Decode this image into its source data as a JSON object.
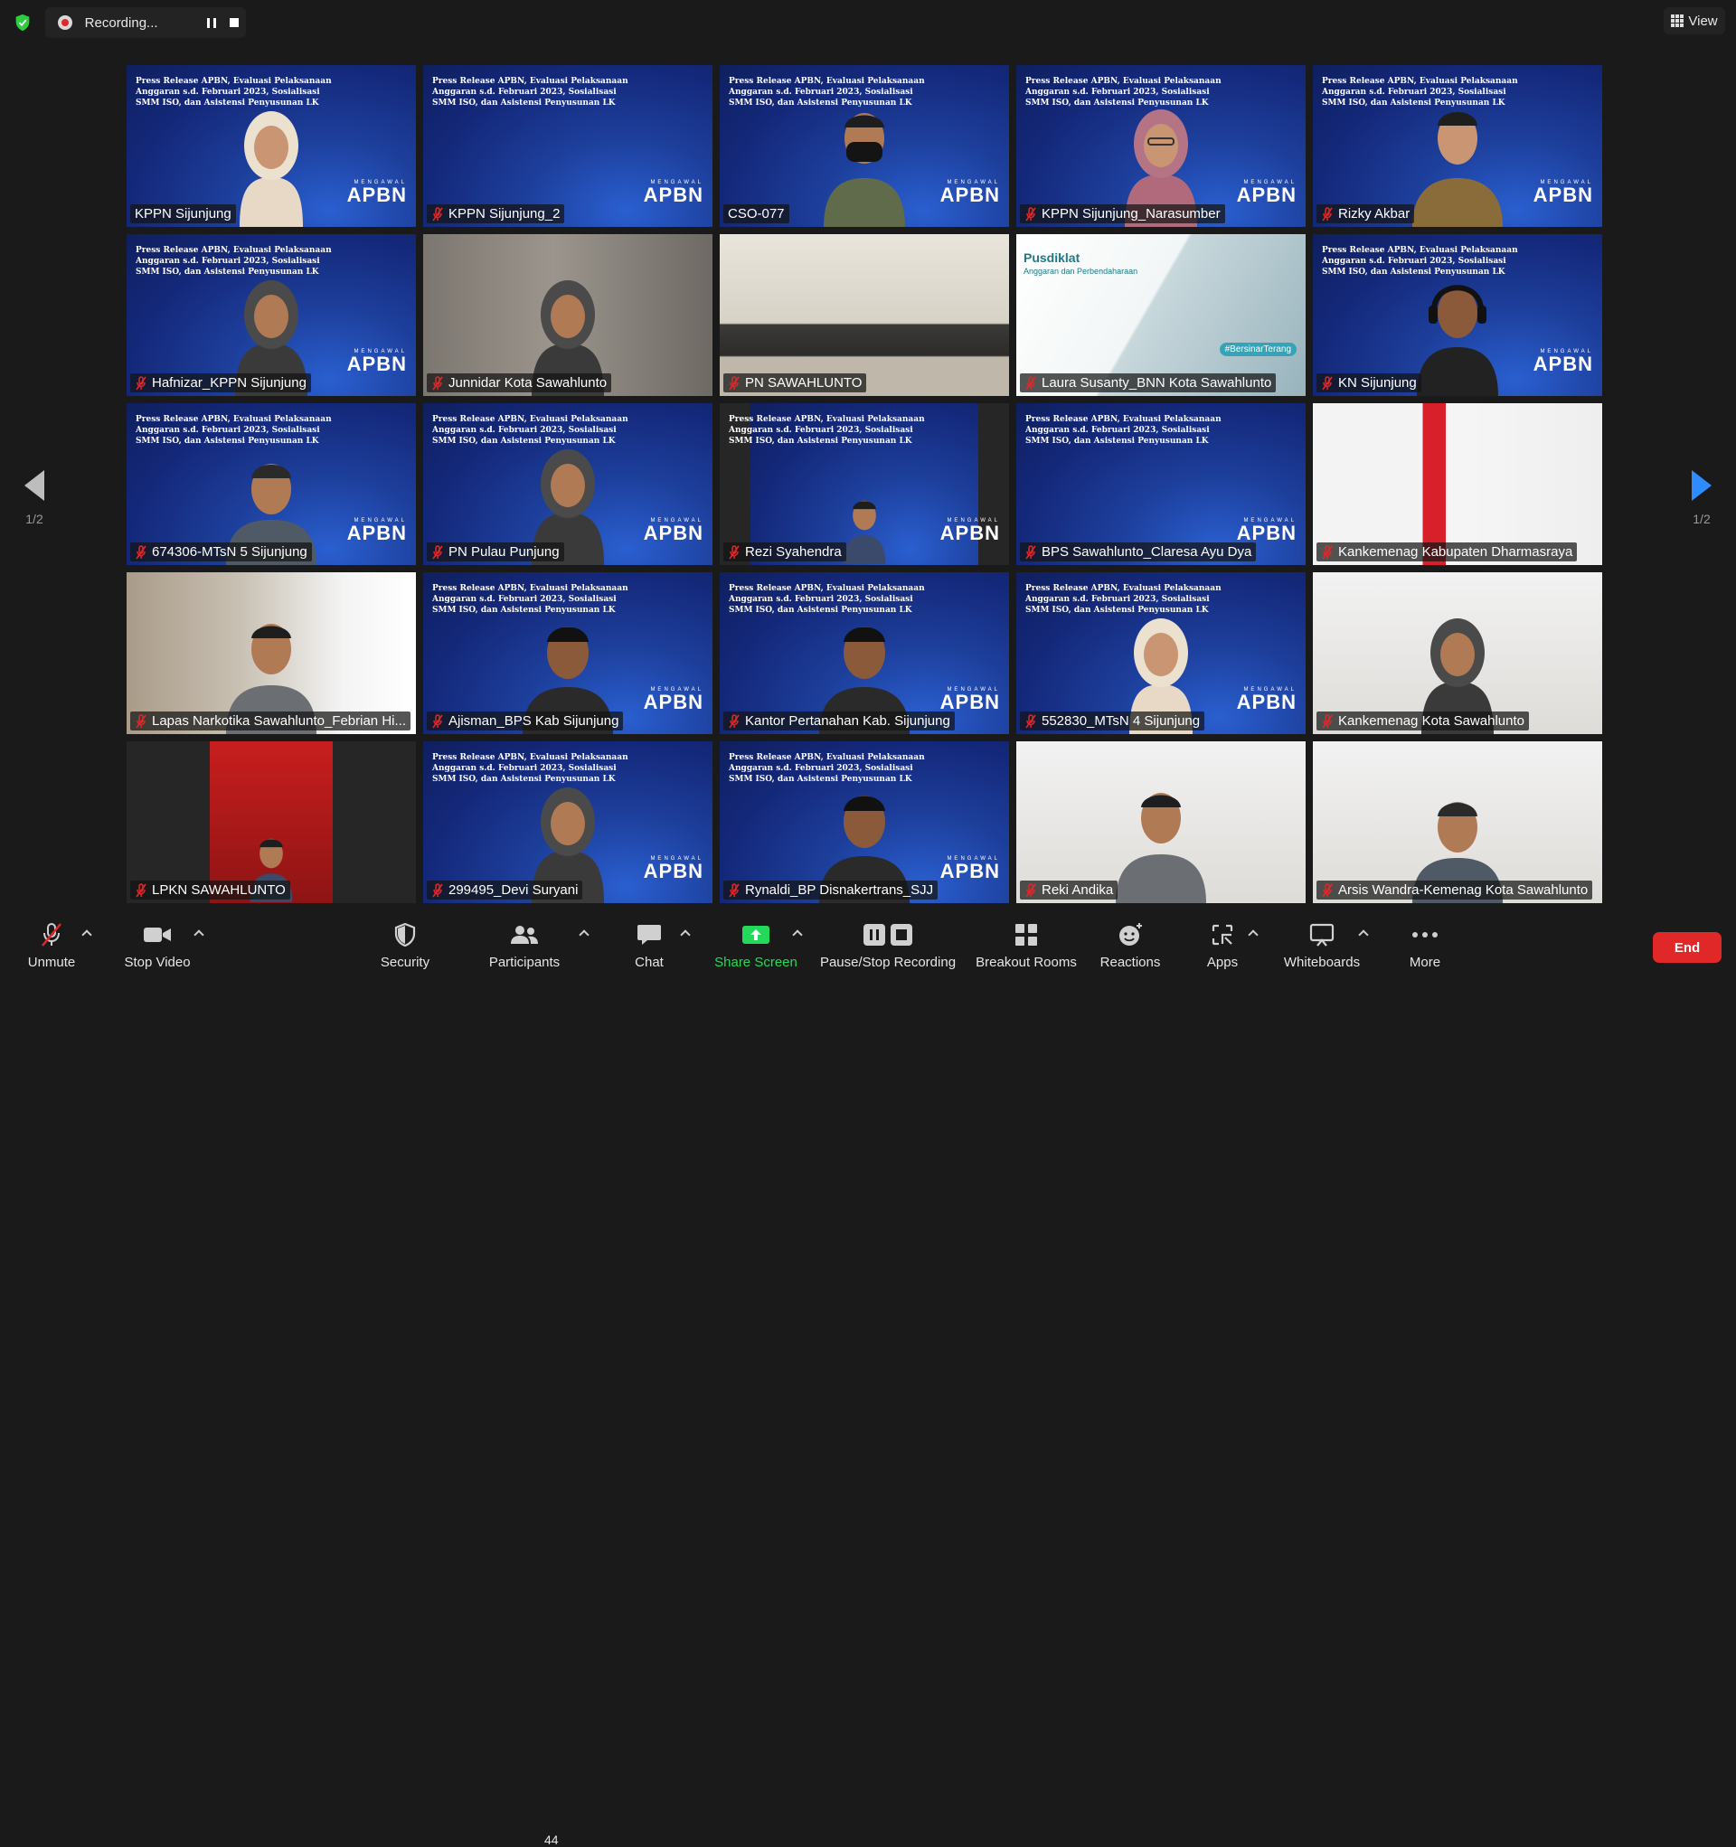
{
  "recording": {
    "label": "Recording..."
  },
  "view": {
    "label": "View"
  },
  "pager": {
    "left": "1/2",
    "right": "1/2"
  },
  "slide": {
    "title": "Press Release APBN, Evaluasi Pelaksanaan Anggaran s.d. Februari 2023, Sosialisasi SMM ISO, dan Asistensi Penyusunan LK",
    "brand_small": "MENGAWAL",
    "brand": "APBN"
  },
  "tiles": [
    {
      "name": "KPPN Sijunjung",
      "muted": false
    },
    {
      "name": "KPPN Sijunjung_2",
      "muted": true
    },
    {
      "name": "CSO-077",
      "muted": false
    },
    {
      "name": "KPPN Sijunjung_Narasumber",
      "muted": true
    },
    {
      "name": "Rizky Akbar",
      "muted": true
    },
    {
      "name": "Hafnizar_KPPN Sijunjung",
      "muted": true
    },
    {
      "name": "Junnidar Kota Sawahlunto",
      "muted": true
    },
    {
      "name": "PN SAWAHLUNTO",
      "muted": true
    },
    {
      "name": "Laura Susanty_BNN Kota Sawahlunto",
      "muted": true
    },
    {
      "name": "KN Sijunjung",
      "muted": true
    },
    {
      "name": "674306-MTsN 5 Sijunjung",
      "muted": true
    },
    {
      "name": "PN Pulau Punjung",
      "muted": true
    },
    {
      "name": "Rezi Syahendra",
      "muted": true
    },
    {
      "name": "BPS Sawahlunto_Claresa Ayu Dya",
      "muted": true
    },
    {
      "name": "Kankemenag  Kabupaten Dharmasraya",
      "muted": true
    },
    {
      "name": "Lapas Narkotika Sawahlunto_Febrian Hi...",
      "muted": true
    },
    {
      "name": "Ajisman_BPS Kab Sijunjung",
      "muted": true
    },
    {
      "name": "Kantor Pertanahan Kab. Sijunjung",
      "muted": true
    },
    {
      "name": "552830_MTsN 4 Sijunjung",
      "muted": true
    },
    {
      "name": "Kankemenag Kota Sawahlunto",
      "muted": true
    },
    {
      "name": "LPKN SAWAHLUNTO",
      "muted": true
    },
    {
      "name": "299495_Devi Suryani",
      "muted": true
    },
    {
      "name": "Rynaldi_BP Disnakertrans_SJJ",
      "muted": true
    },
    {
      "name": "Reki Andika",
      "muted": true
    },
    {
      "name": "Arsis Wandra-Kemenag Kota Sawahlunto",
      "muted": true
    }
  ],
  "pusdiklat": {
    "title": "Pusdiklat",
    "subtitle": "Anggaran dan Perbendaharaan",
    "tag": "#BersinarTerang"
  },
  "toolbar": {
    "unmute": "Unmute",
    "stop_video": "Stop Video",
    "security": "Security",
    "participants": "Participants",
    "participants_count": "44",
    "chat": "Chat",
    "share_screen": "Share Screen",
    "pause_recording": "Pause/Stop Recording",
    "breakout": "Breakout Rooms",
    "reactions": "Reactions",
    "apps": "Apps",
    "whiteboards": "Whiteboards",
    "more": "More",
    "end": "End"
  },
  "colors": {
    "active_speaker": "#c8e23c",
    "end_button": "#e02828",
    "share_green": "#23d959",
    "next_arrow": "#2d8cff"
  }
}
